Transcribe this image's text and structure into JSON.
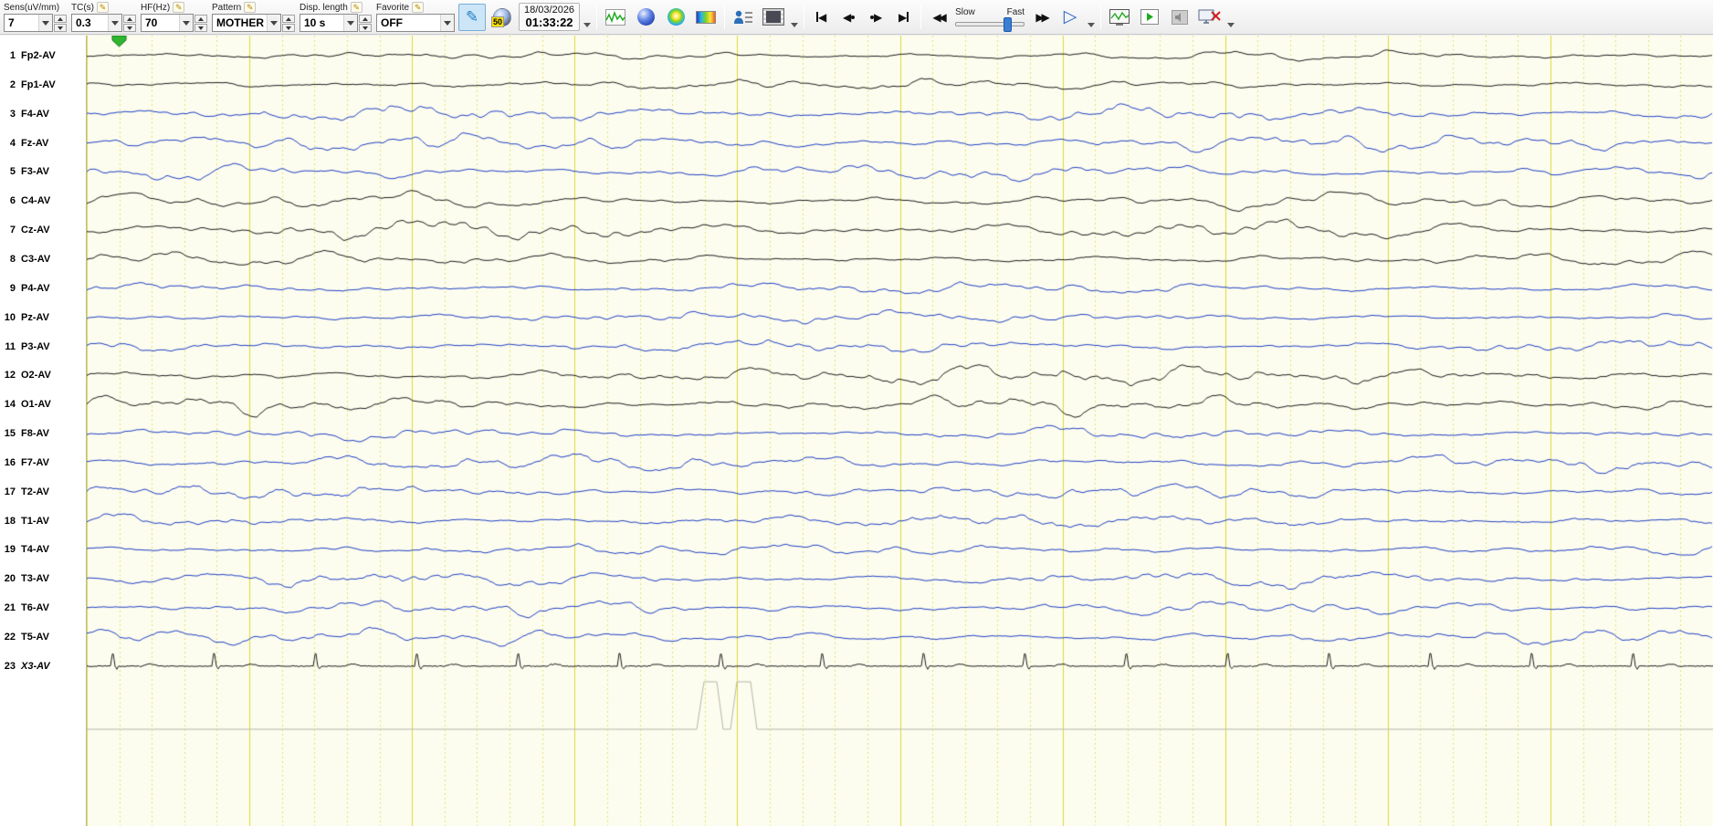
{
  "toolbar": {
    "sens": {
      "label": "Sens(uV/mm)",
      "value": "7"
    },
    "tc": {
      "label": "TC(s)",
      "value": "0.3"
    },
    "hf": {
      "label": "HF(Hz)",
      "value": "70"
    },
    "pattern": {
      "label": "Pattern",
      "value": "MOTHER"
    },
    "disp_length": {
      "label": "Disp. length",
      "value": "10 s"
    },
    "favorite": {
      "label": "Favorite",
      "value": "OFF"
    },
    "notch_badge": "50",
    "date": "18/03/2026",
    "time": "01:33:22",
    "slow_label": "Slow",
    "fast_label": "Fast"
  },
  "display": {
    "seconds": 10,
    "minor_per_second": 5
  },
  "colors": {
    "paper": "#fdfdef",
    "grid_major": "#ddd83a",
    "grid_minor": "#e6e26a",
    "trace_black": "#1c1c1c",
    "trace_blue": "#2040c4",
    "marker_green": "#2fb52f",
    "event_gray": "#b8b8a8"
  },
  "channels": [
    {
      "num": "1",
      "label": "Fp2-AV",
      "color": "black",
      "amp": 5,
      "kind": "eeg"
    },
    {
      "num": "2",
      "label": "Fp1-AV",
      "color": "black",
      "amp": 6,
      "kind": "eeg"
    },
    {
      "num": "3",
      "label": "F4-AV",
      "color": "blue",
      "amp": 8,
      "kind": "eeg"
    },
    {
      "num": "4",
      "label": "Fz-AV",
      "color": "blue",
      "amp": 8,
      "kind": "eeg"
    },
    {
      "num": "5",
      "label": "F3-AV",
      "color": "blue",
      "amp": 8,
      "kind": "eeg"
    },
    {
      "num": "6",
      "label": "C4-AV",
      "color": "black",
      "amp": 8,
      "kind": "eeg"
    },
    {
      "num": "7",
      "label": "Cz-AV",
      "color": "black",
      "amp": 10,
      "kind": "eeg"
    },
    {
      "num": "8",
      "label": "C3-AV",
      "color": "black",
      "amp": 7,
      "kind": "eeg"
    },
    {
      "num": "9",
      "label": "P4-AV",
      "color": "blue",
      "amp": 7,
      "kind": "eeg"
    },
    {
      "num": "10",
      "label": "Pz-AV",
      "color": "blue",
      "amp": 7,
      "kind": "eeg"
    },
    {
      "num": "11",
      "label": "P3-AV",
      "color": "blue",
      "amp": 7,
      "kind": "eeg"
    },
    {
      "num": "12",
      "label": "O2-AV",
      "color": "black",
      "amp": 10,
      "kind": "eeg"
    },
    {
      "num": "14",
      "label": "O1-AV",
      "color": "black",
      "amp": 9,
      "kind": "eeg"
    },
    {
      "num": "15",
      "label": "F8-AV",
      "color": "blue",
      "amp": 7,
      "kind": "eeg"
    },
    {
      "num": "16",
      "label": "F7-AV",
      "color": "blue",
      "amp": 8,
      "kind": "eeg"
    },
    {
      "num": "17",
      "label": "T2-AV",
      "color": "blue",
      "amp": 8,
      "kind": "eeg"
    },
    {
      "num": "18",
      "label": "T1-AV",
      "color": "blue",
      "amp": 8,
      "kind": "eeg"
    },
    {
      "num": "19",
      "label": "T4-AV",
      "color": "blue",
      "amp": 7,
      "kind": "eeg"
    },
    {
      "num": "20",
      "label": "T3-AV",
      "color": "blue",
      "amp": 8,
      "kind": "eeg"
    },
    {
      "num": "21",
      "label": "T6-AV",
      "color": "blue",
      "amp": 8,
      "kind": "eeg"
    },
    {
      "num": "22",
      "label": "T5-AV",
      "color": "blue",
      "amp": 8,
      "kind": "eeg"
    },
    {
      "num": "23",
      "label": "X3-AV",
      "color": "black",
      "amp": 3,
      "kind": "ecg",
      "italic": true
    }
  ]
}
